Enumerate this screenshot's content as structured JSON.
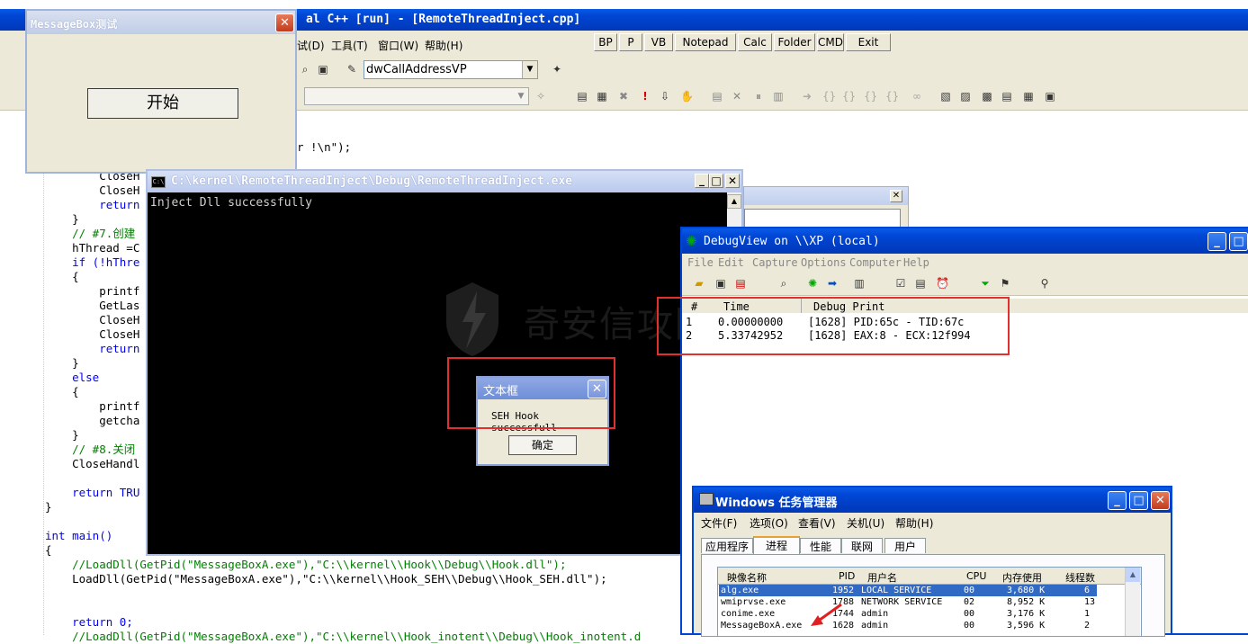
{
  "ide": {
    "title": "al C++ [run] - [RemoteThreadInject.cpp]",
    "menu": [
      "试(D)",
      "工具(T)",
      "窗口(W)",
      "帮助(H)"
    ],
    "quick_buttons": [
      "BP",
      "P",
      "VB",
      "Notepad",
      "Calc",
      "Folder",
      "CMD",
      "Exit"
    ],
    "combo_value": "dwCallAddressVP",
    "code_top": "r !\\n\");",
    "code_lines": [
      {
        "text": "        CloseH"
      },
      {
        "text": "        CloseH"
      },
      {
        "text": "        return"
      },
      {
        "text": "    }"
      },
      {
        "text": "    // #7.创建"
      },
      {
        "text": "    hThread =C"
      },
      {
        "text": "    if (!hThre"
      },
      {
        "text": "    {"
      },
      {
        "text": "        printf"
      },
      {
        "text": "        GetLas"
      },
      {
        "text": "        CloseH"
      },
      {
        "text": "        CloseH"
      },
      {
        "text": "        return"
      },
      {
        "text": "    }"
      },
      {
        "text": "    else"
      },
      {
        "text": "    {"
      },
      {
        "text": "        printf"
      },
      {
        "text": "        getcha"
      },
      {
        "text": "    }"
      },
      {
        "text": "    // #8.关闭"
      },
      {
        "text": "    CloseHandl"
      },
      {
        "text": ""
      },
      {
        "text": "    return TRU"
      },
      {
        "text": "}"
      },
      {
        "text": ""
      },
      {
        "text": "int main()"
      },
      {
        "text": "{"
      },
      {
        "text": "    //LoadDll(GetPid(\"MessageBoxA.exe\"),\"C:\\\\kernel\\\\Hook\\\\Debug\\\\Hook.dll\");"
      },
      {
        "text": "    LoadDll(GetPid(\"MessageBoxA.exe\"),\"C:\\\\kernel\\\\Hook_SEH\\\\Debug\\\\Hook_SEH.dll\");"
      },
      {
        "text": ""
      },
      {
        "text": ""
      },
      {
        "text": "    return 0;"
      },
      {
        "text": "    //LoadDll(GetPid(\"MessageBoxA.exe\"),\"C:\\\\kernel\\\\Hook_inotent\\\\Debug\\\\Hook_inotent.d"
      }
    ]
  },
  "msgbox_test": {
    "title": "MessageBox测试",
    "button": "开始"
  },
  "console": {
    "title": "C:\\kernel\\RemoteThreadInject\\Debug\\RemoteThreadInject.exe",
    "output": "Inject Dll successfully"
  },
  "dialog": {
    "title": "文本框",
    "message": "SEH Hook successfull",
    "ok": "确定"
  },
  "watermark": "奇安信攻防社区",
  "debugview": {
    "title": "DebugView on \\\\XP (local)",
    "menu": [
      "File",
      "Edit",
      "Capture",
      "Options",
      "Computer",
      "Help"
    ],
    "columns": [
      "#",
      "Time",
      "Debug Print"
    ],
    "rows": [
      {
        "n": "1",
        "time": "0.00000000",
        "msg": "[1628] PID:65c - TID:67c"
      },
      {
        "n": "2",
        "time": "5.33742952",
        "msg": "[1628] EAX:8 - ECX:12f994"
      }
    ]
  },
  "taskmgr": {
    "title": "Windows 任务管理器",
    "menu": [
      "文件(F)",
      "选项(O)",
      "查看(V)",
      "关机(U)",
      "帮助(H)"
    ],
    "tabs": [
      "应用程序",
      "进程",
      "性能",
      "联网",
      "用户"
    ],
    "columns": [
      "映像名称",
      "PID",
      "用户名",
      "CPU",
      "内存使用",
      "线程数"
    ],
    "rows": [
      {
        "name": "alg.exe",
        "pid": "1952",
        "user": "LOCAL SERVICE",
        "cpu": "00",
        "mem": "3,680 K",
        "threads": "6",
        "selected": true
      },
      {
        "name": "wmiprvse.exe",
        "pid": "1788",
        "user": "NETWORK SERVICE",
        "cpu": "02",
        "mem": "8,952 K",
        "threads": "13"
      },
      {
        "name": "conime.exe",
        "pid": "1744",
        "user": "admin",
        "cpu": "00",
        "mem": "3,176 K",
        "threads": "1"
      },
      {
        "name": "MessageBoxA.exe",
        "pid": "1628",
        "user": "admin",
        "cpu": "00",
        "mem": "3,596 K",
        "threads": "2"
      }
    ]
  },
  "colors": {
    "xp_title": "#0046d5",
    "highlight_red": "#e03030",
    "code_keyword": "#0000ff",
    "code_comment": "#008000"
  }
}
